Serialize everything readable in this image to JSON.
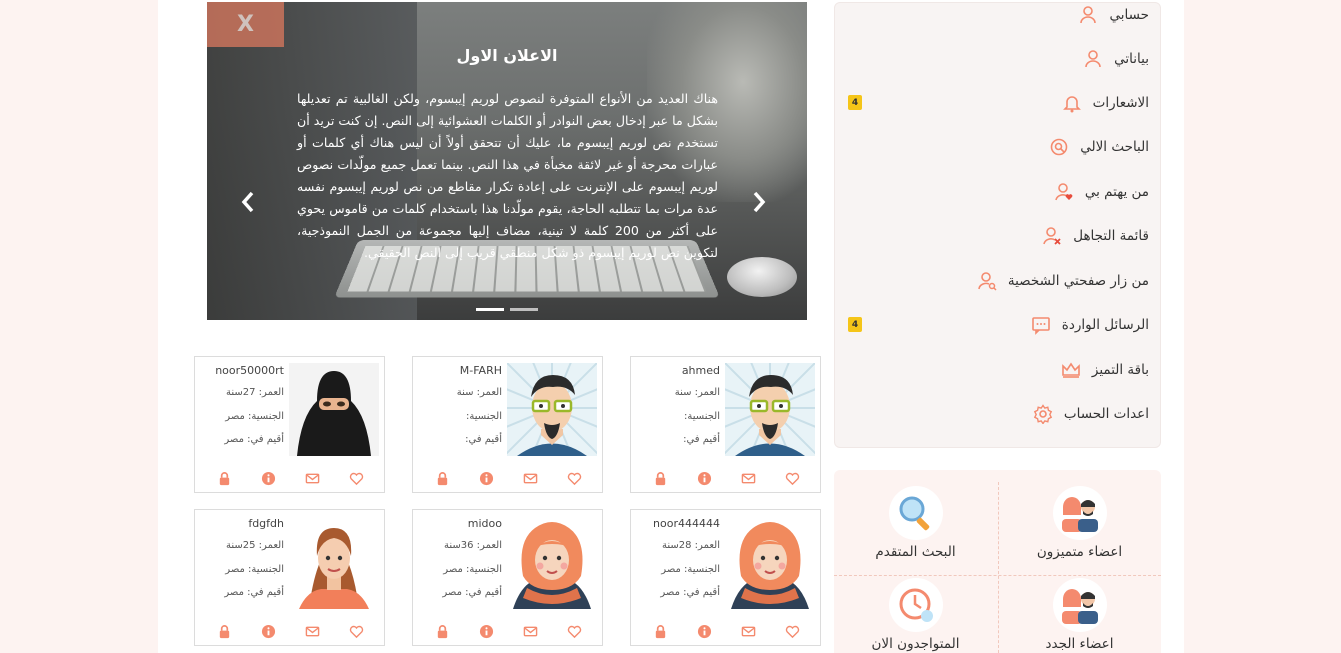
{
  "menu": {
    "items": [
      {
        "label": "حسابي",
        "icon": "user-icon"
      },
      {
        "label": "بياناتي",
        "icon": "user-icon"
      },
      {
        "label": "الاشعارات",
        "icon": "bell-icon",
        "badge": "4"
      },
      {
        "label": "الباحث الالي",
        "icon": "search-badge-icon"
      },
      {
        "label": "من يهتم بي",
        "icon": "user-heart-icon"
      },
      {
        "label": "قائمة التجاهل",
        "icon": "user-block-icon"
      },
      {
        "label": "من زار صفحتي الشخصية",
        "icon": "user-search-icon"
      },
      {
        "label": "الرسائل الواردة",
        "icon": "chat-icon",
        "badge": "4"
      },
      {
        "label": "باقة التميز",
        "icon": "crown-icon"
      },
      {
        "label": "اعدات الحساب",
        "icon": "gear-icon"
      }
    ]
  },
  "quick_links": [
    {
      "label": "اعضاء متميزون",
      "icon": "couple-icon"
    },
    {
      "label": "البحث المتقدم",
      "icon": "magnifier-icon"
    },
    {
      "label": "اعضاء الجدد",
      "icon": "couple-icon"
    },
    {
      "label": "المتواجدون الان",
      "icon": "clock-icon"
    }
  ],
  "ad": {
    "close": "X",
    "title": "الاعلان الاول",
    "body": "هناك العديد من الأنواع المتوفرة لنصوص لوريم إيبسوم، ولكن الغالبية تم تعديلها بشكل ما عبر إدخال بعض النوادر أو الكلمات العشوائية إلى النص. إن كنت تريد أن تستخدم نص لوريم إيبسوم ما، عليك أن تتحقق أولاً أن ليس هناك أي كلمات أو عبارات محرجة أو غير لائقة مخبأة في هذا النص. بينما تعمل جميع مولّدات نصوص لوريم إيبسوم على الإنترنت على إعادة تكرار مقاطع من نص لوريم إيبسوم نفسه عدة مرات بما تتطلبه الحاجة، يقوم مولّدنا هذا باستخدام كلمات من قاموس يحوي على أكثر من 200 كلمة لا تينية، مضاف إليها مجموعة من الجمل النموذجية، لتكوين نص لوريم إيبسوم ذو شكل منطقي قريب إلى النص الحقيقي.",
    "prev": "‹",
    "next": "›",
    "slides_total": 2,
    "slide_active": 1
  },
  "members": [
    {
      "username": "ahmed",
      "age": "العمر: سنة",
      "nationality": "الجنسية:",
      "residence": "أقيم في:",
      "avatar": "man-glasses-avatar"
    },
    {
      "username": "M-FARH",
      "age": "العمر: سنة",
      "nationality": "الجنسية:",
      "residence": "أقيم في:",
      "avatar": "man-glasses-avatar"
    },
    {
      "username": "noor50000rt",
      "age": "العمر: 27سنة",
      "nationality": "الجنسية: مصر",
      "residence": "أقيم في: مصر",
      "avatar": "niqab-avatar"
    },
    {
      "username": "noor444444",
      "age": "العمر: 28سنة",
      "nationality": "الجنسية: مصر",
      "residence": "أقيم في: مصر",
      "avatar": "hijab-avatar"
    },
    {
      "username": "midoo",
      "age": "العمر: 36سنة",
      "nationality": "الجنسية: مصر",
      "residence": "أقيم في: مصر",
      "avatar": "hijab-avatar"
    },
    {
      "username": "fdgfdh",
      "age": "العمر: 25سنة",
      "nationality": "الجنسية: مصر",
      "residence": "أقيم في: مصر",
      "avatar": "woman-avatar"
    }
  ],
  "colors": {
    "accent": "#f48a6e",
    "badge": "#f5c518",
    "menu_bg": "#f8f4f3"
  }
}
